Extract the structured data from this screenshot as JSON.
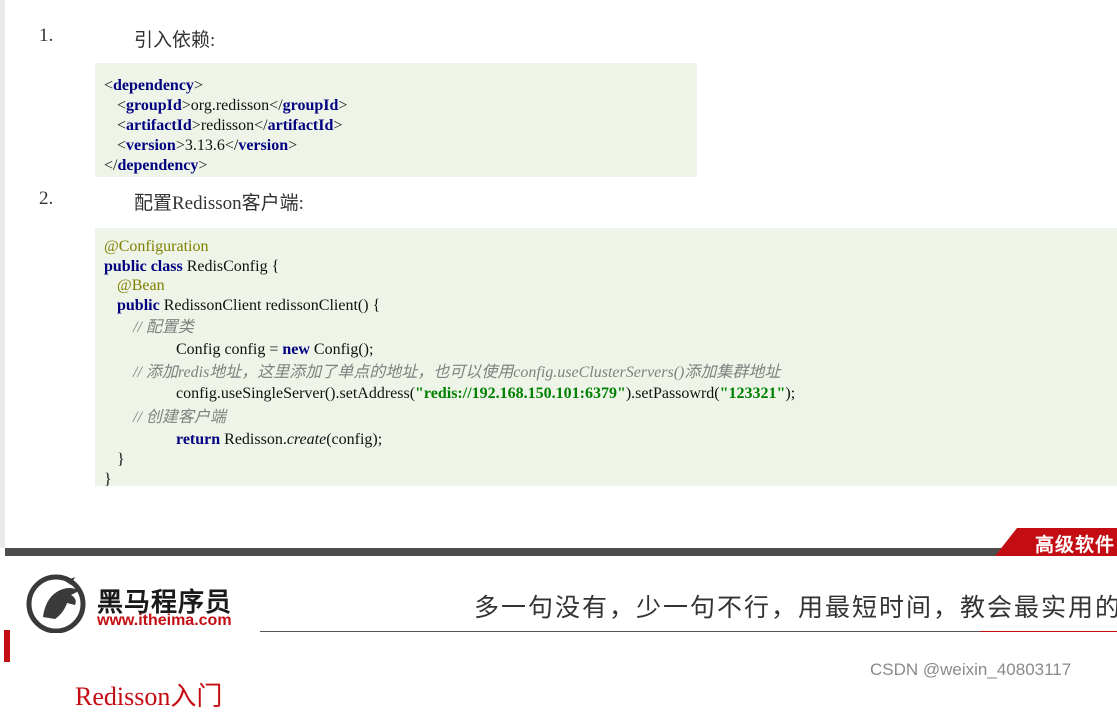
{
  "steps": [
    {
      "num": "1.",
      "text": "引入依赖:"
    },
    {
      "num": "2.",
      "text": "配置Redisson客户端:"
    }
  ],
  "dependency": {
    "open_tag": "dependency",
    "group_tag": "groupId",
    "group_value": "org.redisson",
    "artifact_tag": "artifactId",
    "artifact_value": "redisson",
    "version_tag": "version",
    "version_value": "3.13.6"
  },
  "config_code": {
    "annotation_configuration": "@Configuration",
    "kw_public_class": "public class",
    "class_decl": " RedisConfig {",
    "annotation_bean": "@Bean",
    "kw_public": "public",
    "method_decl": " RedissonClient redissonClient() {",
    "comment_config": "// 配置类",
    "config_decl_prefix": "Config config = ",
    "kw_new": "new",
    "config_decl_suffix": " Config();",
    "comment_address": "// 添加redis地址，这里添加了单点的地址，也可以使用config.useClusterServers()添加集群地址",
    "address_prefix": "config.useSingleServer().setAddress(",
    "address_value": "\"redis://192.168.150.101:6379\"",
    "address_mid": ").setPassowrd(",
    "password_value": "\"123321\"",
    "address_suffix": ");",
    "comment_create": "// 创建客户端",
    "kw_return": "return",
    "return_prefix": " Redisson.",
    "return_method": "create",
    "return_suffix": "(config);",
    "close_method": "}",
    "close_class": "}"
  },
  "footer": {
    "tab_label": "高级软件",
    "brand_name": "黑马程序员",
    "brand_url": "www.itheima.com",
    "slogan": "多一句没有，少一句不行，用最短时间，教会最实用的",
    "watermark": "CSDN @weixin_40803117",
    "next_title": "Redisson入门"
  },
  "colors": {
    "code_bg": "#eef5e8",
    "keyword": "#000080",
    "annotation": "#808000",
    "comment": "#808080",
    "string": "#008000",
    "accent_red": "#c40d12"
  }
}
